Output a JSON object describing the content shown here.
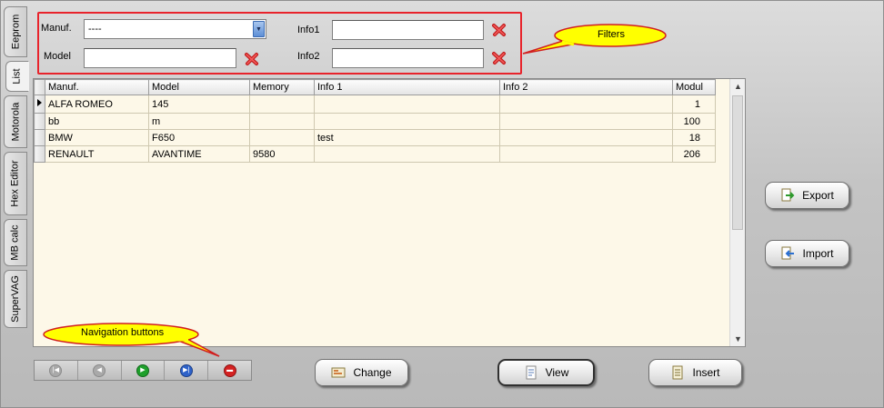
{
  "side_tabs": [
    {
      "label": "Eeprom",
      "active": false
    },
    {
      "label": "List",
      "active": true
    },
    {
      "label": "Motorola",
      "active": false
    },
    {
      "label": "Hex Editor",
      "active": false
    },
    {
      "label": "MB calc",
      "active": false
    },
    {
      "label": "SuperVAG",
      "active": false
    }
  ],
  "filters": {
    "manuf_label": "Manuf.",
    "manuf_value": "----",
    "model_label": "Model",
    "model_value": "",
    "info1_label": "Info1",
    "info1_value": "",
    "info2_label": "Info2",
    "info2_value": ""
  },
  "callouts": {
    "filters": "Filters",
    "navigation": "Navigation buttons"
  },
  "grid": {
    "columns": [
      "Manuf.",
      "Model",
      "Memory",
      "Info 1",
      "Info 2",
      "Modul"
    ],
    "rows": [
      {
        "manuf": "ALFA ROMEO",
        "model": "145",
        "memory": "",
        "info1": "",
        "info2": "",
        "modul": "1",
        "current": true
      },
      {
        "manuf": "bb",
        "model": "m",
        "memory": "",
        "info1": "",
        "info2": "",
        "modul": "100",
        "current": false
      },
      {
        "manuf": "BMW",
        "model": "F650",
        "memory": "",
        "info1": "test",
        "info2": "",
        "modul": "18",
        "current": false
      },
      {
        "manuf": "RENAULT",
        "model": "AVANTIME",
        "memory": "9580",
        "info1": "",
        "info2": "",
        "modul": "206",
        "current": false
      }
    ]
  },
  "buttons": {
    "export": "Export",
    "import": "Import",
    "change": "Change",
    "view": "View",
    "insert": "Insert"
  },
  "nav_icons": [
    "first-record-icon",
    "prior-record-icon",
    "next-record-icon",
    "last-record-icon",
    "cancel-icon"
  ],
  "colors": {
    "filter_border": "#e8232b",
    "callout_fill": "#ffff00",
    "grid_background": "#fdf8e8"
  }
}
